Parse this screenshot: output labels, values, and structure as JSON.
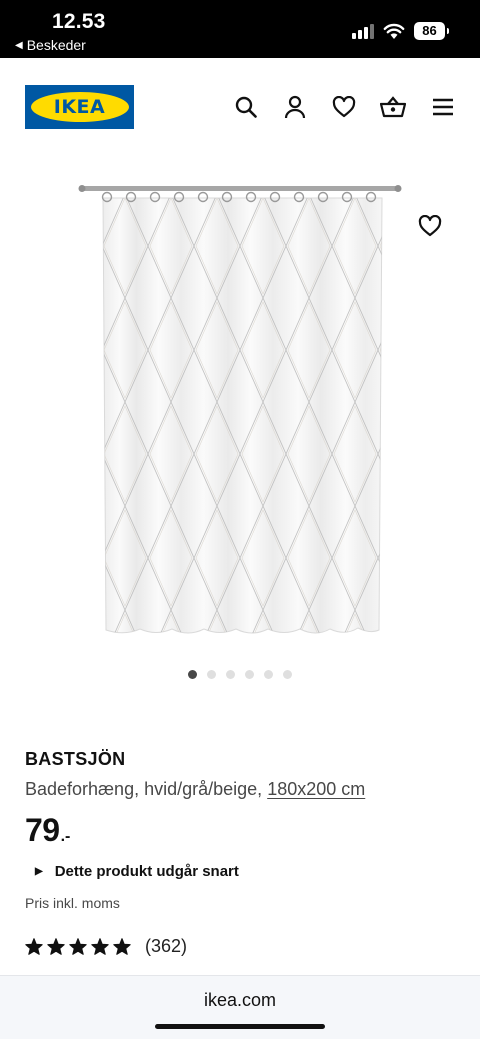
{
  "status_bar": {
    "time": "12.53",
    "back_label": "Beskeder",
    "battery": "86"
  },
  "header": {
    "logo_text": "IKEA",
    "icons": [
      "search-icon",
      "account-icon",
      "heart-icon",
      "basket-icon",
      "menu-icon"
    ]
  },
  "carousel": {
    "total": 6,
    "active_index": 0
  },
  "product": {
    "name": "BASTSJÖN",
    "description": "Badeforhæng, hvid/grå/beige,",
    "size": "180x200 cm",
    "price_integer": "79",
    "price_decimal": ".-",
    "notice": "Dette produkt udgår snart",
    "vat_text": "Pris inkl. moms",
    "rating_value": 5,
    "rating_max": 5,
    "review_count": "(362)"
  },
  "browser": {
    "url": "ikea.com"
  },
  "colors": {
    "ikea_blue": "#0058a3",
    "ikea_yellow": "#ffdb00",
    "text": "#111111",
    "muted": "#484848"
  }
}
